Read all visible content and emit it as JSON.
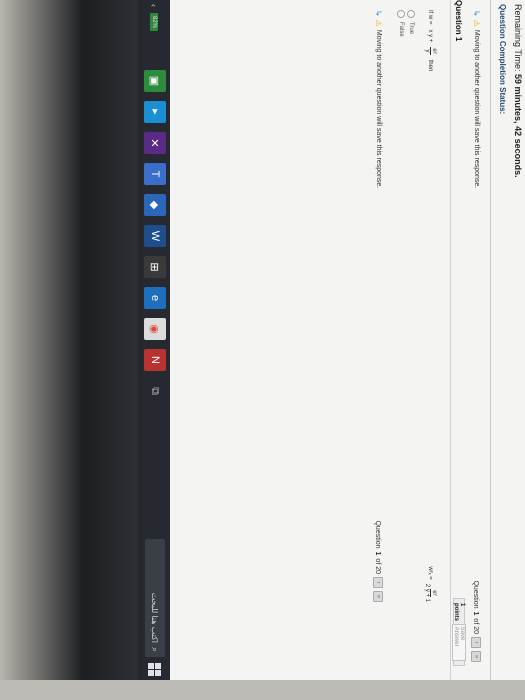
{
  "header": {
    "remaining_prefix": "Remaining Time:",
    "remaining_value": "59 minutes, 42 seconds.",
    "completion_label": "Question Completion Status:"
  },
  "notices": {
    "top_warning": "Moving to another question will save this response.",
    "bottom_warning": "Moving to another question will save this response."
  },
  "question_nav": {
    "top_counter_prefix": "Question",
    "top_counter_num": "1",
    "top_counter_of": "of 20",
    "bottom_counter_prefix": "Question",
    "bottom_counter_num": "1",
    "bottom_counter_of": "of 20"
  },
  "question": {
    "title": "Question 1",
    "points": "1 points",
    "save_label": "Save Answer",
    "stem_if": "If w =",
    "stem_expr": "x y +",
    "stem_num": "eʸ",
    "stem_den": "y",
    "stem_then": "then",
    "eq_lhs": "wʸₓ =",
    "eq_num": "eʸ",
    "eq_den": "2 y + 1",
    "options": [
      "True",
      "False"
    ]
  },
  "taskbar": {
    "battery": "82%",
    "search_placeholder": "اكتب هنا للبحث",
    "apps": [
      "bluestacks-icon",
      "prime-icon",
      "mail-icon",
      "teams-icon",
      "cube-icon",
      "word-icon",
      "store-icon",
      "edge-icon",
      "chrome-icon",
      "photo-icon",
      "taskview-icon"
    ]
  }
}
